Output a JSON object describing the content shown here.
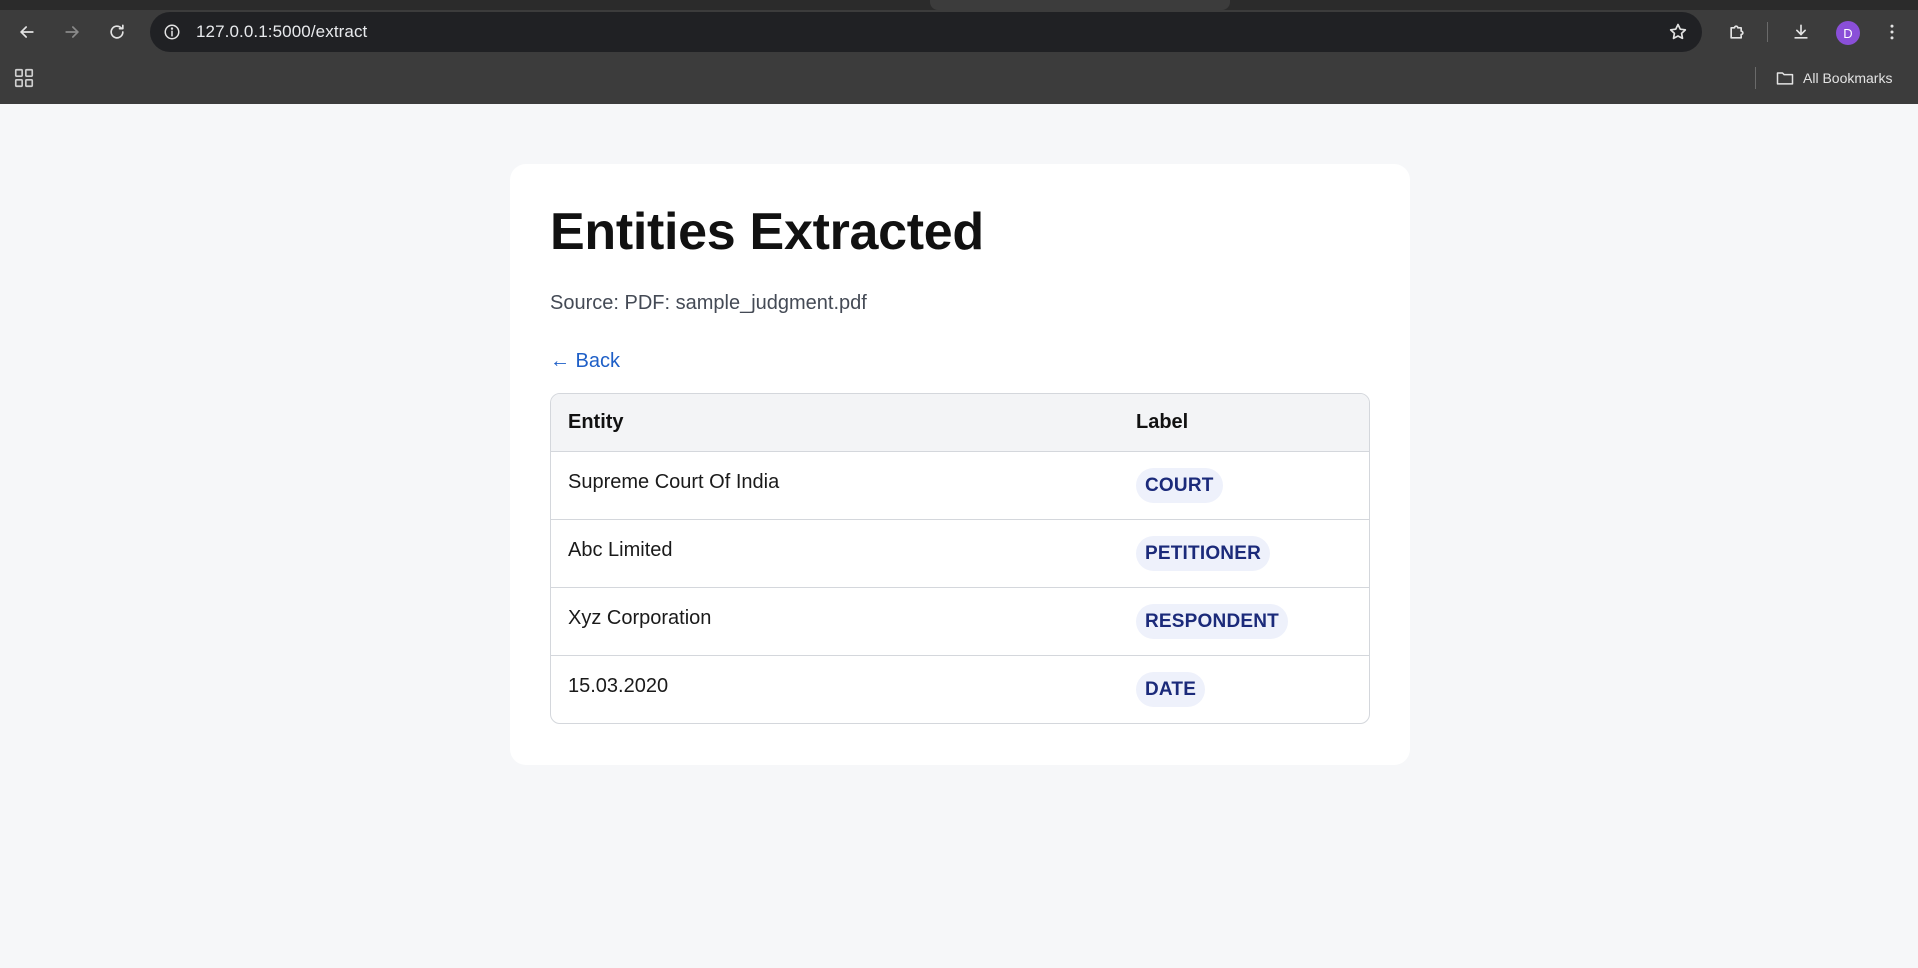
{
  "browser": {
    "url": "127.0.0.1:5000/extract",
    "avatar_initial": "D",
    "all_bookmarks_label": "All Bookmarks",
    "avatar_color": "#8a4fd8"
  },
  "page": {
    "title": "Entities Extracted",
    "source_text": "Source: PDF: sample_judgment.pdf",
    "back_label": "← Back",
    "table": {
      "headers": [
        "Entity",
        "Label"
      ],
      "rows": [
        {
          "entity": "Supreme Court Of India",
          "label": "COURT"
        },
        {
          "entity": "Abc Limited",
          "label": "PETITIONER"
        },
        {
          "entity": "Xyz Corporation",
          "label": "RESPONDENT"
        },
        {
          "entity": "15.03.2020",
          "label": "DATE"
        }
      ]
    }
  },
  "colors": {
    "link": "#1e5fc7",
    "pill_bg": "#eef1fb",
    "pill_text": "#1b2a7a"
  }
}
